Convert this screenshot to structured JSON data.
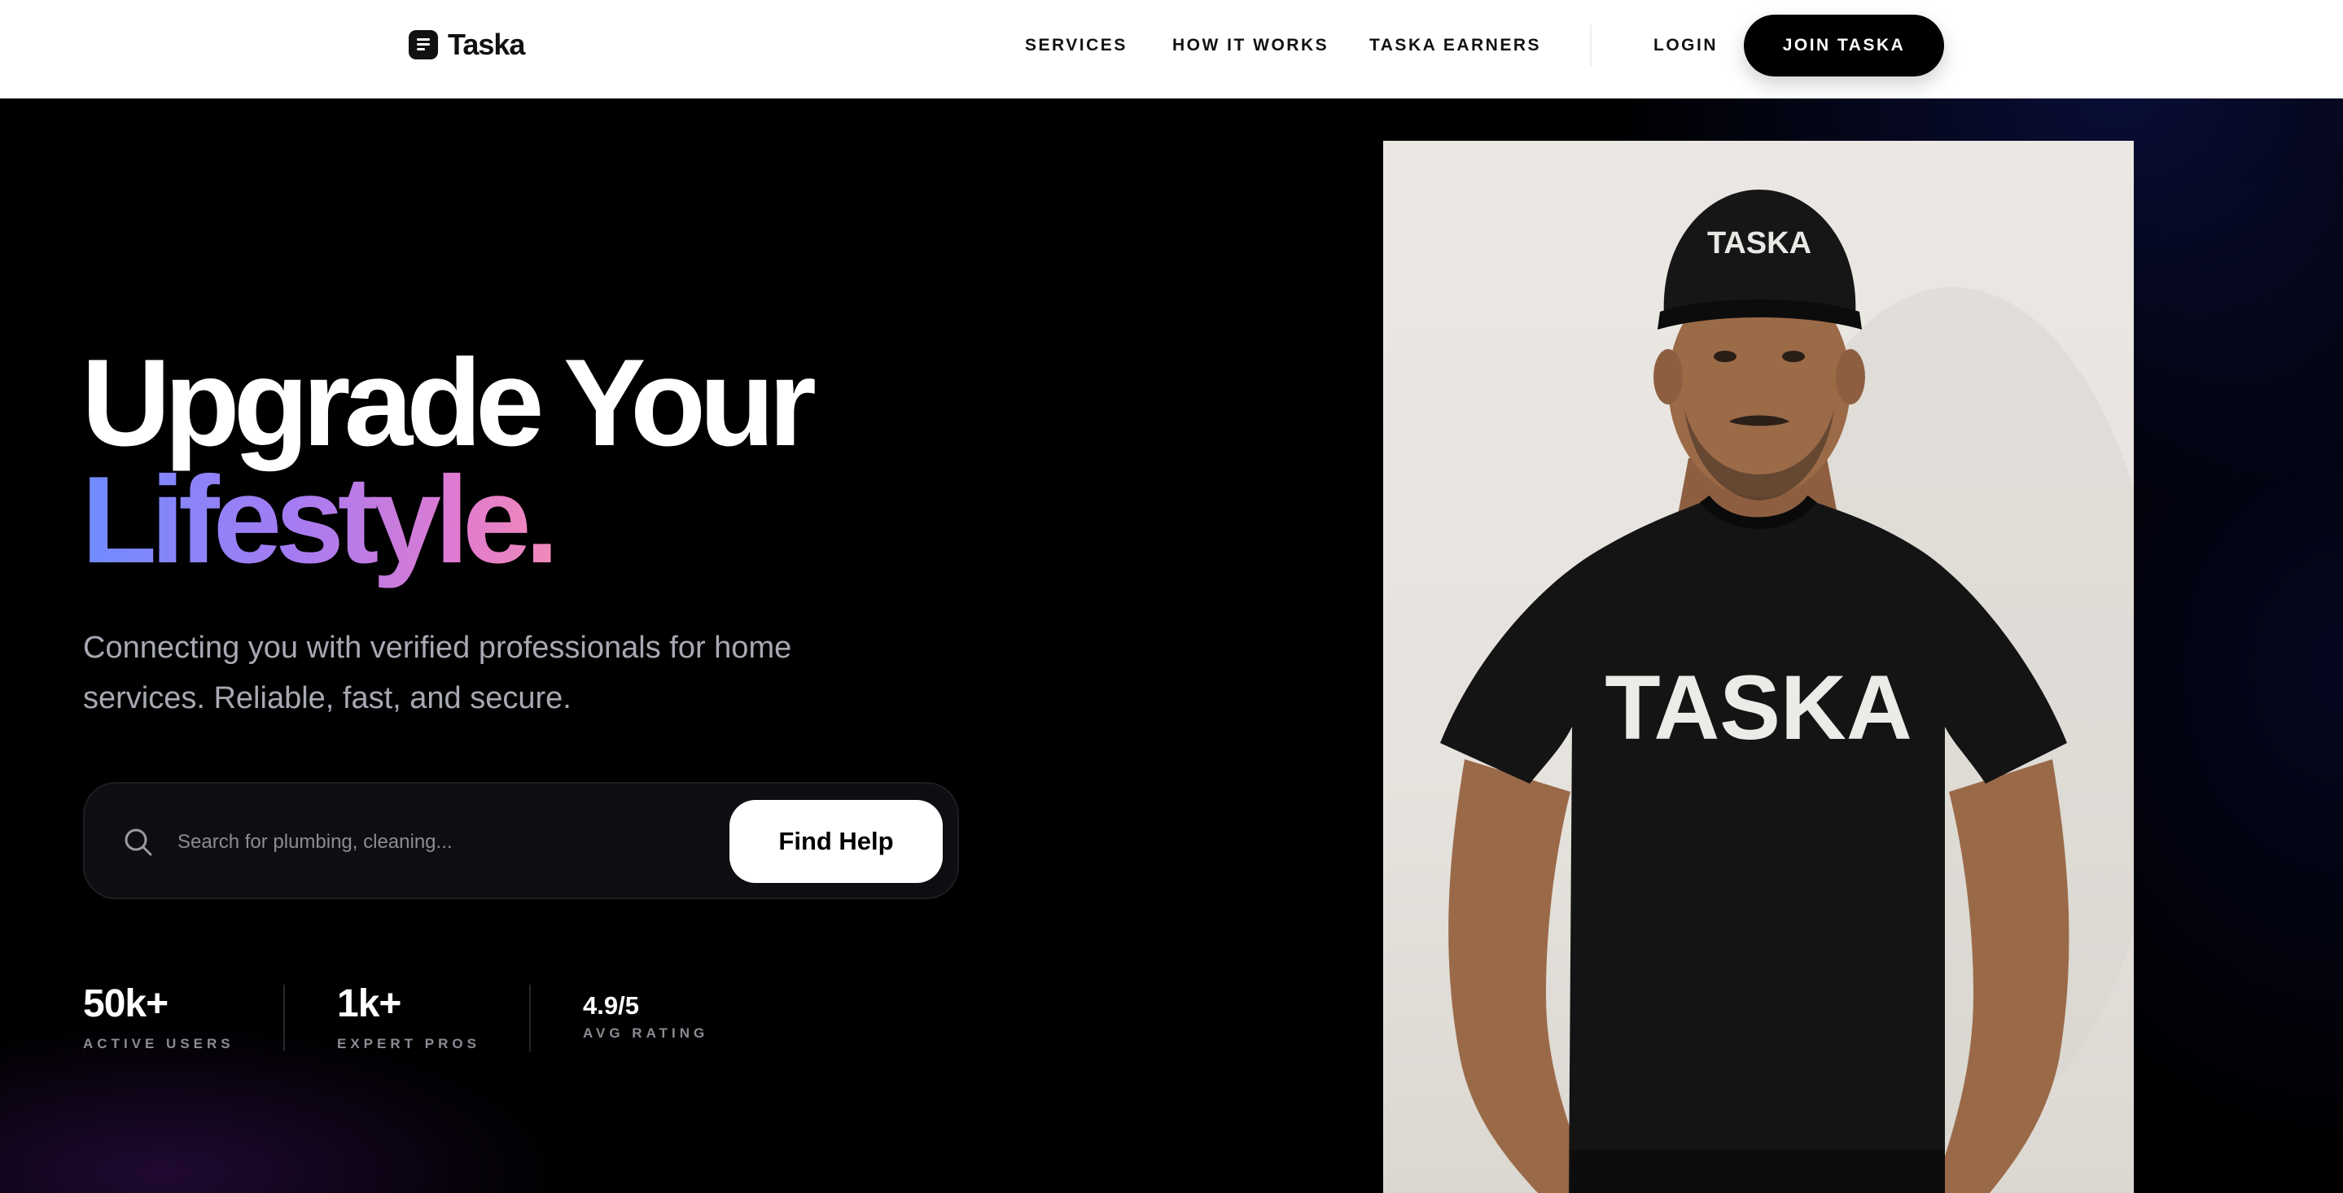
{
  "brand": {
    "name": "Taska"
  },
  "nav": {
    "links": [
      "SERVICES",
      "HOW IT WORKS",
      "TASKA EARNERS"
    ],
    "login": "LOGIN",
    "cta": "JOIN TASKA"
  },
  "hero": {
    "headline_line1": "Upgrade Your",
    "headline_line2": "Lifestyle.",
    "subtitle": "Connecting you with verified professionals for home services. Reliable, fast, and secure.",
    "search_placeholder": "Search for plumbing, cleaning...",
    "search_button": "Find Help"
  },
  "stats": [
    {
      "value": "50k+",
      "label": "ACTIVE USERS"
    },
    {
      "value": "1k+",
      "label": "EXPERT PROS"
    },
    {
      "value": "4.9/5",
      "label": "AVG RATING"
    }
  ],
  "photo": {
    "cap_text": "TASKA",
    "shirt_text": "TASKA"
  },
  "colors": {
    "background": "#000000",
    "header": "#ffffff",
    "gradient_start": "#6f8cff",
    "gradient_end": "#f08ab8",
    "muted_text": "#a7a9b2"
  }
}
